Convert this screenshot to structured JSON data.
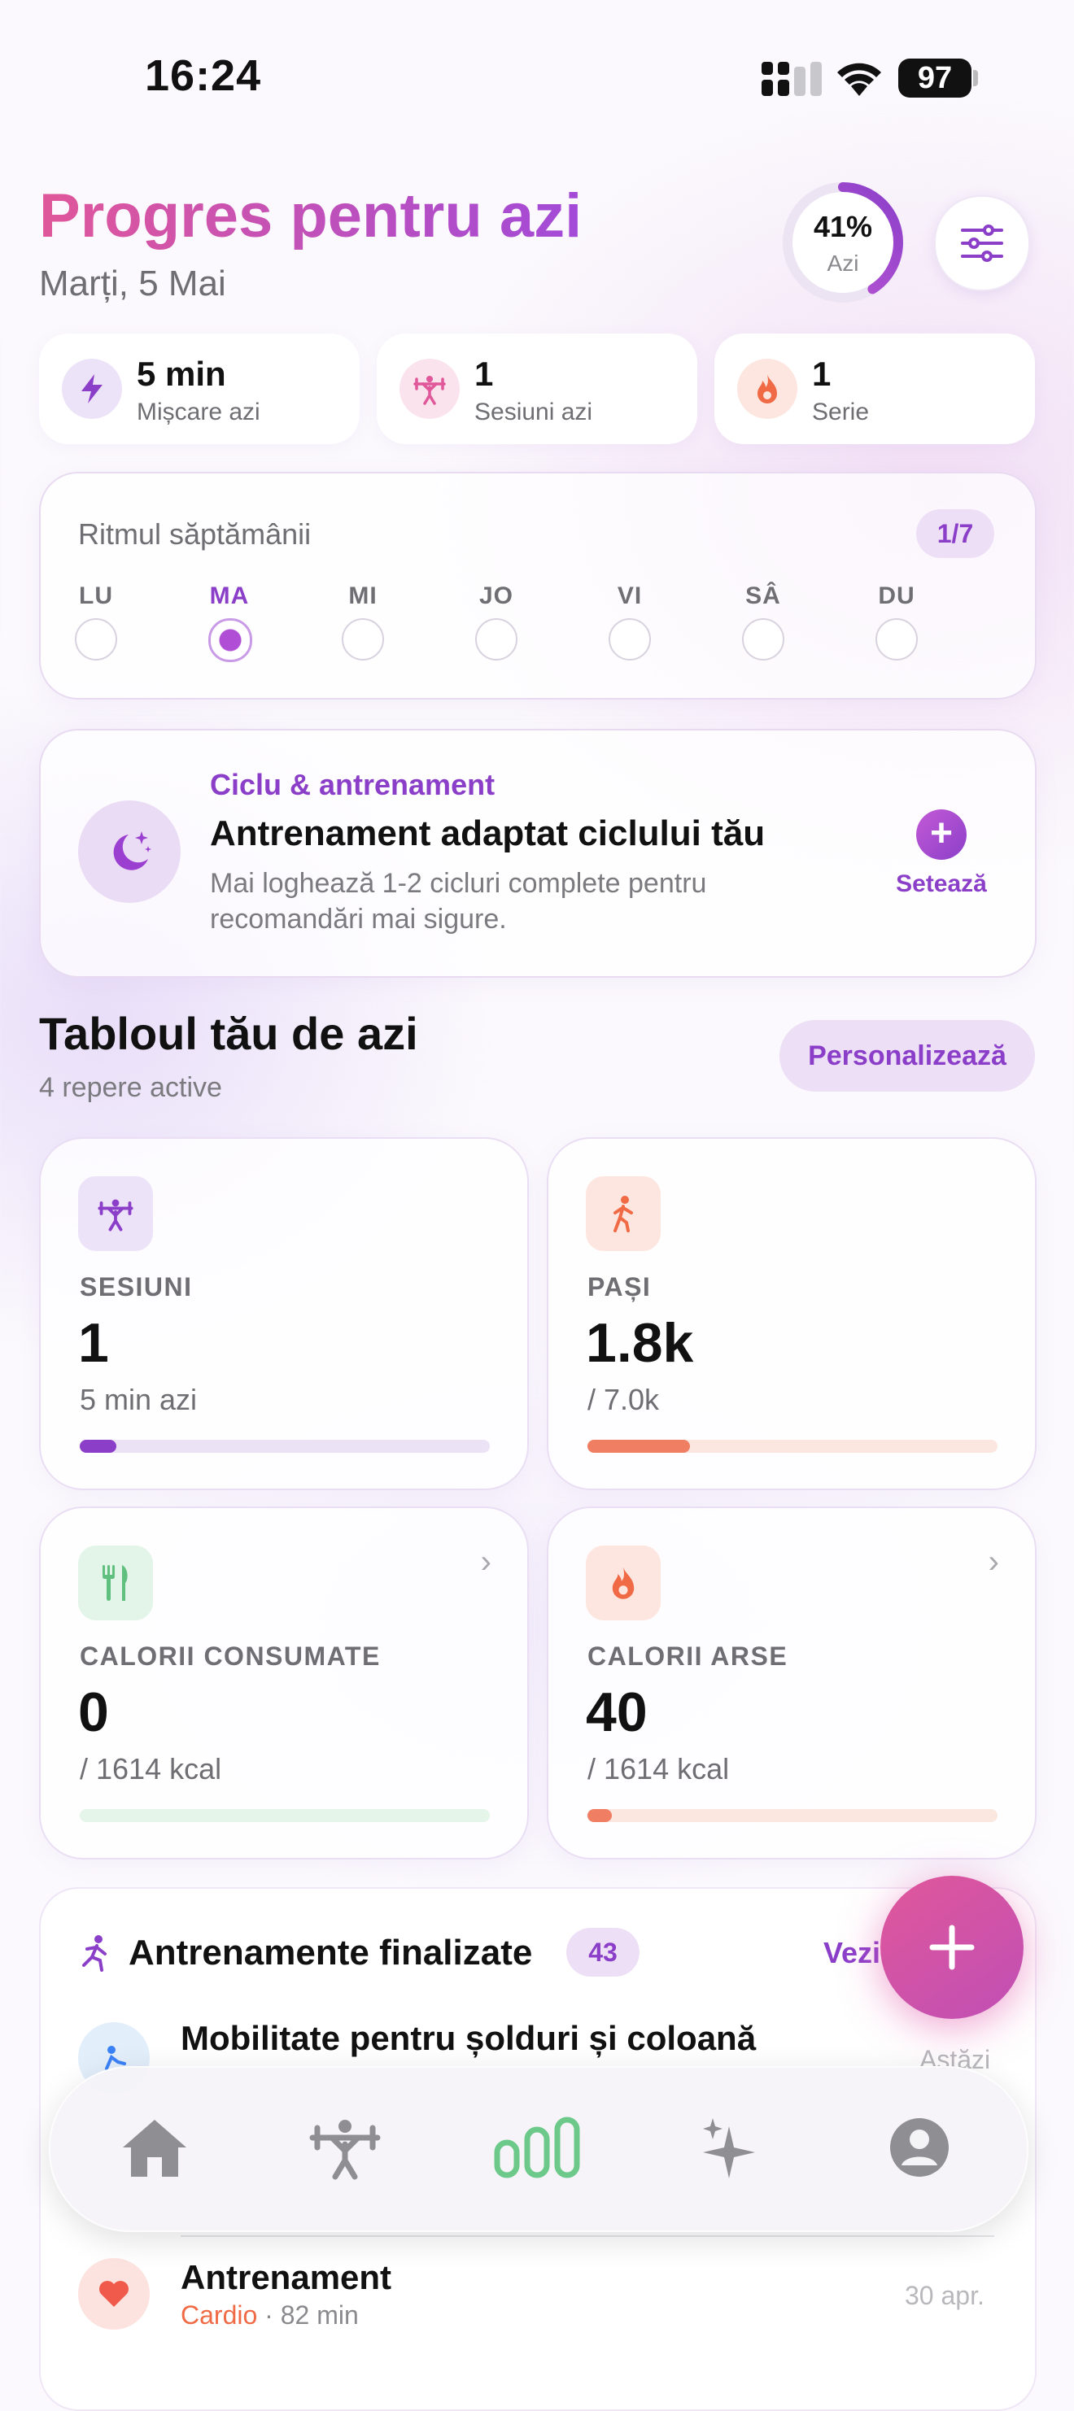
{
  "status_bar": {
    "time": "16:24",
    "battery": "97"
  },
  "header": {
    "title": "Progres pentru azi",
    "date": "Marți, 5 Mai",
    "ring_percent": "41%",
    "ring_label": "Azi",
    "ring_progress": 0.41
  },
  "stats": [
    {
      "value": "5 min",
      "label": "Mișcare azi",
      "icon": "bolt-icon"
    },
    {
      "value": "1",
      "label": "Sesiuni azi",
      "icon": "weightlifting-icon"
    },
    {
      "value": "1",
      "label": "Serie",
      "icon": "flame-icon"
    }
  ],
  "week": {
    "title": "Ritmul săptămânii",
    "badge": "1/7",
    "days": [
      "LU",
      "MA",
      "MI",
      "JO",
      "VI",
      "SÂ",
      "DU"
    ],
    "active_day": "MA"
  },
  "cycle": {
    "tag": "Ciclu & antrenament",
    "title": "Antrenament adaptat ciclului tău",
    "description": "Mai loghează 1-2 cicluri complete pentru recomandări mai sigure.",
    "action": "Setează"
  },
  "dashboard": {
    "title": "Tabloul tău de azi",
    "subtitle": "4 repere active",
    "customize": "Personalizează",
    "tiles": [
      {
        "label": "SESIUNI",
        "value": "1",
        "sub": "5 min azi",
        "progress": 0.09,
        "color": "#8b3fc9"
      },
      {
        "label": "PAȘI",
        "value": "1.8k",
        "sub": "/ 7.0k",
        "progress": 0.25,
        "color": "#ef7e62"
      },
      {
        "label": "CALORII CONSUMATE",
        "value": "0",
        "sub": "/ 1614 kcal",
        "progress": 0,
        "color": "#7bcf93"
      },
      {
        "label": "CALORII ARSE",
        "value": "40",
        "sub": "/ 1614 kcal",
        "progress": 0.06,
        "color": "#ef7e62"
      }
    ]
  },
  "completed": {
    "title": "Antrenamente finalizate",
    "count": "43",
    "see_all": "Vezi",
    "items": [
      {
        "name": "Mobilitate pentru șolduri și coloană",
        "date": "Astăzi"
      },
      {
        "name": "Antrenament",
        "category": "Cardio",
        "meta": "· 82 min",
        "date": "30 apr."
      }
    ]
  },
  "tabbar": {
    "tabs": [
      "home-icon",
      "workout-icon",
      "progress-icon",
      "sparkle-icon",
      "profile-icon"
    ],
    "active": "progress-icon"
  },
  "colors": {
    "accent": "#8b3fc9",
    "pink": "#e0579a",
    "coral": "#ef7e62",
    "green": "#7bcf93"
  }
}
